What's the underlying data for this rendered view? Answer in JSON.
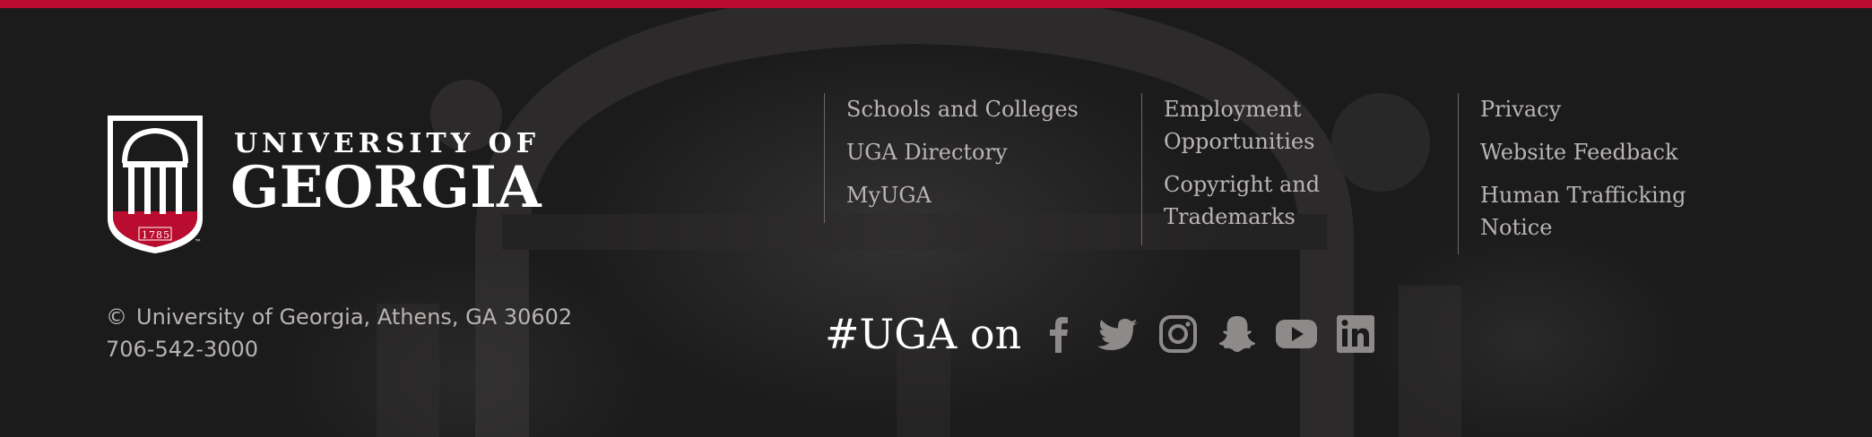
{
  "brand": {
    "line1": "UNIVERSITY OF",
    "line2": "GEORGIA",
    "year": "1785",
    "tm": "™",
    "accent_color": "#ba0c2f"
  },
  "address": {
    "copyright_symbol": "©",
    "line1": "University of Georgia, Athens, GA 30602",
    "phone": "706-542-3000"
  },
  "links": {
    "col1": [
      "Schools and Colleges",
      "UGA Directory",
      "MyUGA"
    ],
    "col2_employment": "Employment Opportunities",
    "col2_copyright": "Copyright and Trademarks",
    "col3_privacy": "Privacy",
    "col3_feedback": "Website Feedback",
    "col3_trafficking": "Human Trafficking Notice"
  },
  "social": {
    "label": "#UGA on",
    "icons": [
      "facebook-icon",
      "twitter-icon",
      "instagram-icon",
      "snapchat-icon",
      "youtube-icon",
      "linkedin-icon"
    ]
  }
}
